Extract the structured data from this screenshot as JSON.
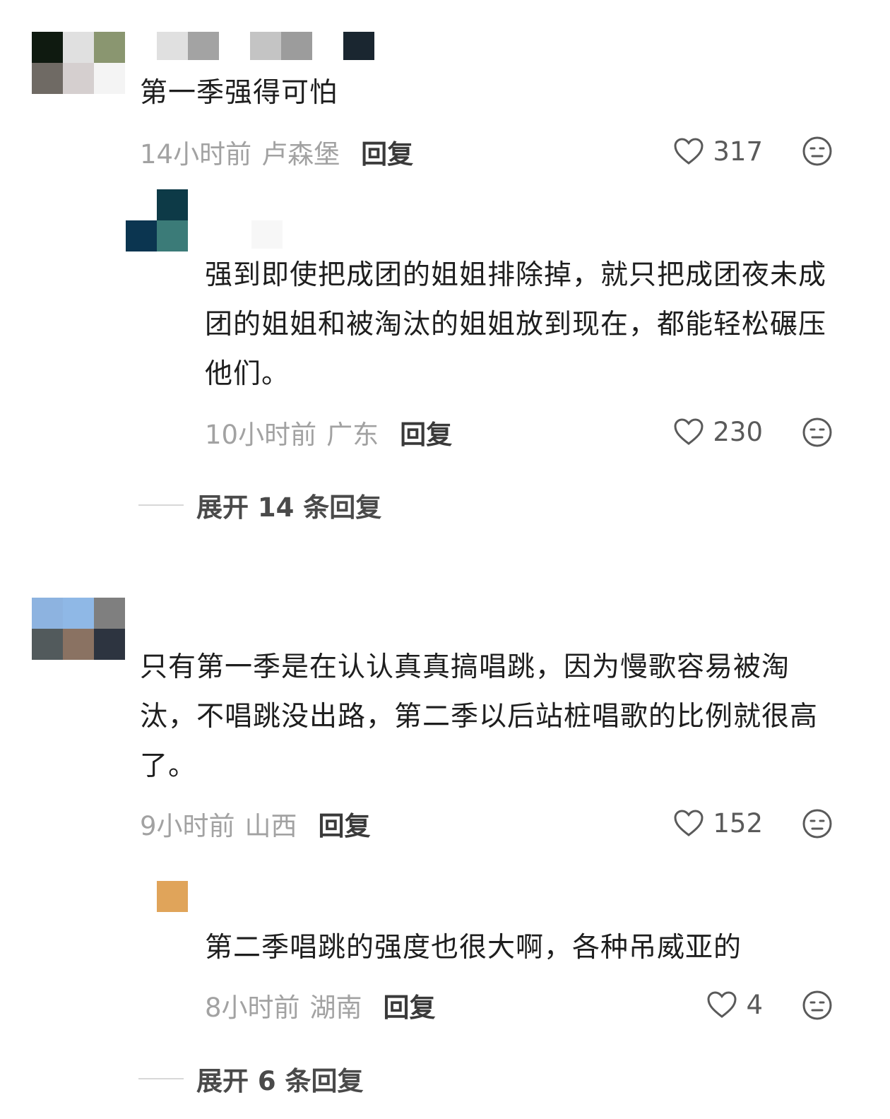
{
  "comments": [
    {
      "text": "第一季强得可怕",
      "time": "14小时前",
      "location": "卢森堡",
      "reply_label": "回复",
      "likes": "317",
      "avatar_colors": [
        "#0f1a10",
        "#e0e0e0",
        "#8a9670",
        "#6f6a64",
        "#d5cfcf",
        "#ffffff"
      ],
      "name_colors": [
        "#e0e0e0",
        "#a3a3a3",
        "#ffffff",
        "#c4c4c4",
        "#9c9c9c",
        "#ffffff",
        "#1a2630"
      ]
    },
    {
      "text": "强到即使把成团的姐姐排除掉，就只把成团夜未成团的姐姐和被淘汰的姐姐放到现在，都能轻松碾压他们。",
      "time": "10小时前",
      "location": "广东",
      "reply_label": "回复",
      "likes": "230",
      "avatar_colors": [
        "#ffffff",
        "#0d3a47",
        "#0b3550",
        "#3b7b78"
      ]
    },
    {
      "text": "只有第一季是在认认真真搞唱跳，因为慢歌容易被淘汰，不唱跳没出路，第二季以后站桩唱歌的比例就很高了。",
      "time": "9小时前",
      "location": "山西",
      "reply_label": "回复",
      "likes": "152",
      "avatar_colors": [
        "#8db3e0",
        "#8fb8e6",
        "#7f7f7f",
        "#525a5c",
        "#8a7262",
        "#2d3440"
      ]
    },
    {
      "text": "第二季唱跳的强度也很大啊，各种吊威亚的",
      "time": "8小时前",
      "location": "湖南",
      "reply_label": "回复",
      "likes": "4",
      "avatar_colors": [
        "#e0a45a"
      ]
    }
  ],
  "expand": [
    {
      "label": "展开 14 条回复"
    },
    {
      "label": "展开 6 条回复"
    }
  ]
}
